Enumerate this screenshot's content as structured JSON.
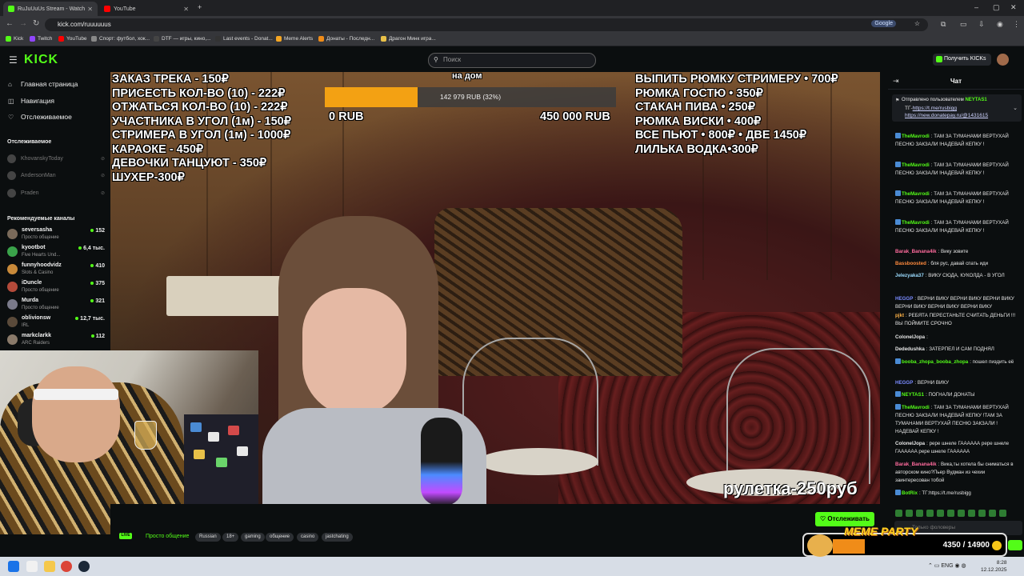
{
  "browser": {
    "tabs": [
      {
        "title": "RuJuUuUs Stream - Watch",
        "active": true
      },
      {
        "title": "YouTube",
        "active": false
      }
    ],
    "url": "kick.com/ruuuuuus",
    "search_engine": "Google",
    "bookmarks": [
      "Kick",
      "Twitch",
      "YouTube",
      "Спорт: футбол, хок...",
      "DTF — игры, кино,...",
      "Last events - Donat...",
      "Meme Alerts",
      "Донаты - Последн...",
      "Драгон Минк игра..."
    ]
  },
  "header": {
    "logo": "KICK",
    "search_placeholder": "Поиск",
    "get_kicks_label": "Получить KICKs"
  },
  "sidebar": {
    "nav": [
      {
        "label": "Главная страница",
        "icon": "home-icon"
      },
      {
        "label": "Навигация",
        "icon": "compass-icon"
      },
      {
        "label": "Отслеживаемое",
        "icon": "heart-icon"
      }
    ],
    "following_title": "Отслеживаемое",
    "following": [
      "KhovanskyToday",
      "AndersonMan",
      "Praden"
    ],
    "recommended_title": "Рекомендуемые каналы",
    "recommended": [
      {
        "name": "seversasha",
        "category": "Просто общение",
        "viewers": "152"
      },
      {
        "name": "kyootbot",
        "category": "Five Hearts Und...",
        "viewers": "6,4 тыс."
      },
      {
        "name": "funnyhoodvidz",
        "category": "Slots & Casino",
        "viewers": "410"
      },
      {
        "name": "iDuncle",
        "category": "Просто общение",
        "viewers": "375"
      },
      {
        "name": "Murda",
        "category": "Просто общение",
        "viewers": "321"
      },
      {
        "name": "oblivionsw",
        "category": "IRL",
        "viewers": "12,7 тыс."
      },
      {
        "name": "markclarkk",
        "category": "ARC Raiders",
        "viewers": "112"
      }
    ]
  },
  "stream_overlay": {
    "price_list_left": [
      "ЗАКАЗ ТРЕКА - 150₽",
      "ПРИСЕСТЬ КОЛ-ВО (10) - 222₽",
      "ОТЖАТЬСЯ КОЛ-ВО (10) - 222₽",
      "УЧАСТНИКА В УГОЛ (1м)  - 150₽",
      "СТРИМЕРА В УГОЛ (1м) - 1000₽",
      "КАРАОКЕ - 450₽",
      "ДЕВОЧКИ ТАНЦУЮТ - 350₽",
      "ШУХЕР-300₽"
    ],
    "price_list_right": [
      "ВЫПИТЬ РЮМКУ СТРИМЕРУ • 700₽",
      "РЮМКА ГОСТЮ • 350₽",
      "СТАКАН ПИВА • 250₽",
      "РЮМКА ВИСКИ • 400₽",
      "ВСЕ ПЬЮТ • 800₽ • ДВЕ 1450₽",
      "ЛИЛЬКА ВОДКА•300₽"
    ],
    "goal": {
      "title": "на дом",
      "progress_text": "142 979 RUB (32%)",
      "progress": 0.32,
      "min_label": "0 RUB",
      "max_label": "450 000 RUB"
    },
    "roulette": "рулетка-250руб"
  },
  "below_video": {
    "live_badge": "LIVE",
    "category": "Просто общение",
    "tags": [
      "Russian",
      "18+",
      "gaming",
      "общение",
      "casino",
      "jastchating"
    ],
    "follow_label": "Отслеживать"
  },
  "chat": {
    "title": "Чат",
    "pinned": {
      "header": "Отправлено пользователем",
      "user": "NEYTAS1",
      "prefix": "ТГ-",
      "link1": "https://t.me/rusbigg",
      "link2": "https://new.donatepay.ru/@1431615"
    },
    "messages": [
      {
        "user": "TheMavrodi",
        "color": "#53fc18",
        "text": "ТАМ ЗА ТУМАНАМИ ВЕРТУХАЙ ПЕСНЮ ЗАКЗАЛИ !НАДЕВАЙ КЕПКУ !"
      },
      {
        "user": "TheMavrodi",
        "color": "#53fc18",
        "text": "ТАМ ЗА ТУМАНАМИ ВЕРТУХАЙ ПЕСНЮ ЗАКЗАЛИ !НАДЕВАЙ КЕПКУ !"
      },
      {
        "user": "TheMavrodi",
        "color": "#53fc18",
        "text": "ТАМ ЗА ТУМАНАМИ ВЕРТУХАЙ ПЕСНЮ ЗАКЗАЛИ !НАДЕВАЙ КЕПКУ !"
      },
      {
        "user": "TheMavrodi",
        "color": "#53fc18",
        "text": "ТАМ ЗА ТУМАНАМИ ВЕРТУХАЙ ПЕСНЮ ЗАКЗАЛИ !НАДЕВАЙ КЕПКУ !"
      },
      {
        "user": "Barak_Banana4ik",
        "color": "#ff6b9d",
        "text": "Вику зовите"
      },
      {
        "user": "Bassboosted",
        "color": "#ff8a3d",
        "text": "бля рус, давай спать иди"
      },
      {
        "user": "Jelezyaka37",
        "color": "#9bdcff",
        "text": "ВИКУ СЮДА, КУКОЛДА - В УГОЛ"
      },
      {
        "user": "HEGGP",
        "color": "#7a8bff",
        "text": "ВЕРНИ ВИКУ ВЕРНИ ВИКУ ВЕРНИ ВИКУ ВЕРНИ ВИКУ ВЕРНИ ВИКУ ВЕРНИ ВИКУ"
      },
      {
        "user": "pjkt",
        "color": "#ffb347",
        "text": "РЕБЯТА ПЕРЕСТАНЬТЕ СЧИТАТЬ ДЕНЬГИ !!! ВЫ ПОЙМИТЕ СРОЧНО"
      },
      {
        "user": "ColonelJopa",
        "color": "#e6e6e6",
        "text": ""
      },
      {
        "user": "Dededushka",
        "color": "#e6e6e6",
        "text": "ЗАТЕРПЕЛ И САМ ПОДНЯЛ"
      },
      {
        "user": "booba_zhopa_booba_zhopa",
        "color": "#53fc18",
        "text": "пошел пиздить её"
      },
      {
        "user": "HEGGP",
        "color": "#7a8bff",
        "text": "ВЕРНИ ВИКУ"
      },
      {
        "user": "NEYTAS1",
        "color": "#53fc18",
        "text": "ПОГНАЛИ ДОНАТЫ"
      },
      {
        "user": "TheMavrodi",
        "color": "#53fc18",
        "text": "ТАМ ЗА ТУМАНАМИ ВЕРТУХАЙ ПЕСНЮ ЗАКЗАЛИ !НАДЕВАЙ КЕПКУ !ТАМ ЗА ТУМАНАМИ ВЕРТУХАЙ ПЕСНЮ ЗАКЗАЛИ !НАДЕВАЙ КЕПКУ !"
      },
      {
        "user": "ColonelJopa",
        "color": "#e6e6e6",
        "text": "рере шнеле ГАААААА рере шнеле ГАААААА рере шнеле ГАААААА"
      },
      {
        "user": "Barak_Banana4ik",
        "color": "#ff6b9d",
        "text": "Вика,ты хотела бы сниматься в авторском кино?Пьер Вудман из чехии заинтересован тобой"
      },
      {
        "user": "BotRix",
        "color": "#53fc18",
        "text": "ТГ:https://t.me/rusbigg"
      }
    ],
    "input_placeholder": "Только фоловеры"
  },
  "meme_widget": {
    "title": "MEME PARTY",
    "value": "4350 / 14900",
    "progress": 0.29
  },
  "taskbar": {
    "lang": "ENG",
    "time": "8:28",
    "date": "12.12.2025"
  }
}
